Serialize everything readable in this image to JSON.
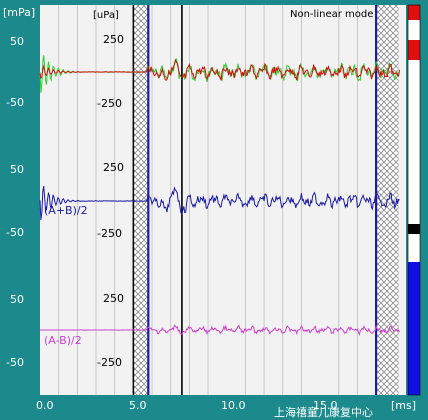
{
  "header": {
    "left_unit": "[mPa]",
    "mid_unit": "[uPa]",
    "mode_label": "Non-linear mode"
  },
  "left_axis": {
    "panel1": [
      "50",
      "-50"
    ],
    "panel2": [
      "50",
      "-50"
    ],
    "panel3": [
      "50",
      "-50"
    ]
  },
  "mid_axis": {
    "panel1": [
      "250",
      "-250"
    ],
    "panel2": [
      "250",
      "-250"
    ],
    "panel3": [
      "250",
      "-250"
    ]
  },
  "trace_labels": {
    "sum": "(A+B)/2",
    "diff": "(A-B)/2"
  },
  "x_axis": {
    "ticks": [
      "0.0",
      "5.0",
      "10.0",
      "15.0"
    ],
    "unit": "[ms]"
  },
  "watermark": "上海禧童儿康复中心",
  "colors": {
    "background": "#1c8a8c",
    "plot_bg": "#f2f2f2",
    "grid": "#bdbdbd",
    "trace_a": "#2fcf2f",
    "trace_b": "#d01010",
    "trace_sum": "#1a1aa8",
    "trace_diff": "#d040d0",
    "marker_blue": "#1a1aa8",
    "marker_black": "#000000"
  },
  "markers": {
    "black_ms": [
      5.0,
      7.6
    ],
    "blue_ms": [
      5.8,
      18.0
    ],
    "hatched_ms": [
      [
        5.0,
        5.8
      ],
      [
        18.0,
        19.2
      ]
    ]
  },
  "side_bar": {
    "segments": [
      {
        "color": "#e01010",
        "name": "red-level-top"
      },
      {
        "color": "#ffffff",
        "name": "white-level-top"
      },
      {
        "color": "#e01010",
        "name": "red-level-bottom"
      },
      {
        "color": "#ffffff",
        "name": "white-level-mid"
      },
      {
        "color": "#000000",
        "name": "black-level"
      },
      {
        "color": "#ffffff",
        "name": "white-level-low"
      },
      {
        "color": "#1010e0",
        "name": "blue-level"
      }
    ]
  }
}
